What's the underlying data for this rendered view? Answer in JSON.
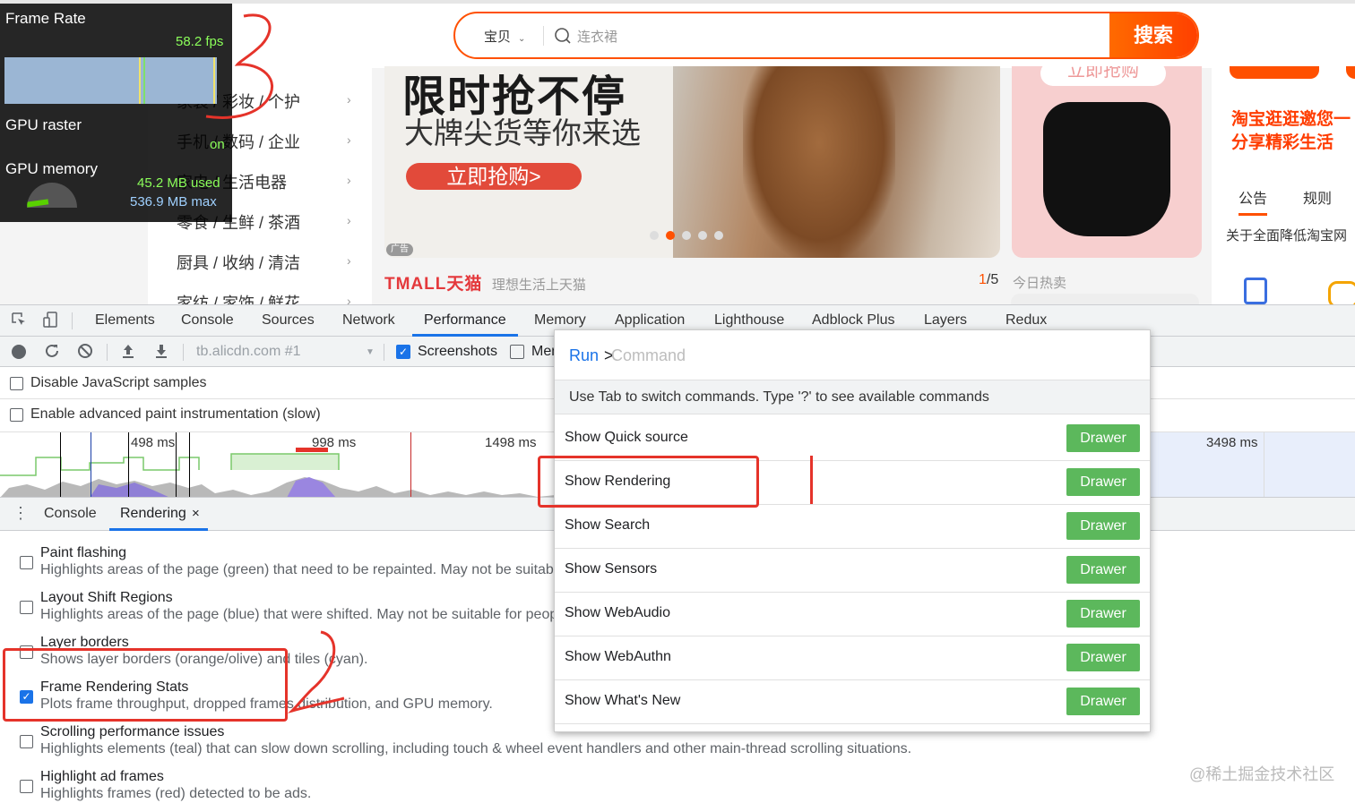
{
  "taobao": {
    "search": {
      "category": "宝贝",
      "placeholder": "连衣裙",
      "button": "搜索"
    },
    "categories": [
      "家装 / 彩妆 / 个护",
      "手机 / 数码 / 企业",
      "家电 / 生活电器",
      "零食 / 生鲜 / 茶酒",
      "厨具 / 收纳 / 清洁",
      "家纺 / 家饰 / 鲜花"
    ],
    "banner": {
      "headline": "限时抢不停",
      "subline": "大牌尖货等你来选",
      "cta": "立即抢购>",
      "ad_badge": "广告"
    },
    "right_card": {
      "button": "立即抢购"
    },
    "side": {
      "slogan1": "淘宝逛逛邀您一",
      "slogan2": "分享精彩生活",
      "tab1": "公告",
      "tab2": "规则",
      "notice": "关于全面降低淘宝网"
    },
    "tmall": {
      "logo": "TMALL天猫",
      "subtitle": "理想生活上天猫",
      "pager_current": "1",
      "pager_total": "/5",
      "hot": "今日热卖"
    }
  },
  "fps_meter": {
    "title": "Frame Rate",
    "fps": "58.2 fps",
    "gpu_raster_label": "GPU raster",
    "gpu_raster_state": "on",
    "gpu_memory_label": "GPU memory",
    "used": "45.2 MB used",
    "max": "536.9 MB max",
    "memory_fraction": 0.084
  },
  "devtools": {
    "tabs": [
      "Elements",
      "Console",
      "Sources",
      "Network",
      "Performance",
      "Memory",
      "Application",
      "Lighthouse",
      "Adblock Plus",
      "Layers",
      "Redux"
    ],
    "active_tab": "Performance",
    "toolbar": {
      "profile": "tb.alicdn.com #1",
      "screenshots": "Screenshots",
      "memory": "Mem"
    },
    "options": [
      "Disable JavaScript samples",
      "Enable advanced paint instrumentation (slow)"
    ],
    "timeline_labels": [
      "498 ms",
      "998 ms",
      "1498 ms",
      "3498 ms"
    ],
    "drawer": {
      "tab_console": "Console",
      "tab_rendering": "Rendering",
      "close": "×"
    },
    "rendering": [
      {
        "title": "Paint flashing",
        "desc": "Highlights areas of the page (green) that need to be repainted. May not be suitabl",
        "checked": false
      },
      {
        "title": "Layout Shift Regions",
        "desc": "Highlights areas of the page (blue) that were shifted. May not be suitable for peop",
        "checked": false
      },
      {
        "title": "Layer borders",
        "desc": "Shows layer borders (orange/olive) and tiles (cyan).",
        "checked": false
      },
      {
        "title": "Frame Rendering Stats",
        "desc": "Plots frame throughput, dropped frames distribution, and GPU memory.",
        "checked": true
      },
      {
        "title": "Scrolling performance issues",
        "desc": "Highlights elements (teal) that can slow down scrolling, including touch & wheel event handlers and other main-thread scrolling situations.",
        "checked": false
      },
      {
        "title": "Highlight ad frames",
        "desc": "Highlights frames (red) detected to be ads.",
        "checked": false
      }
    ]
  },
  "command_menu": {
    "run": "Run",
    "prompt": ">",
    "placeholder": "Command",
    "hint": "Use Tab to switch commands. Type '?' to see available commands",
    "items": [
      {
        "label": "Show Quick source",
        "badge": "Drawer"
      },
      {
        "label": "Show Rendering",
        "badge": "Drawer"
      },
      {
        "label": "Show Search",
        "badge": "Drawer"
      },
      {
        "label": "Show Sensors",
        "badge": "Drawer"
      },
      {
        "label": "Show WebAudio",
        "badge": "Drawer"
      },
      {
        "label": "Show WebAuthn",
        "badge": "Drawer"
      },
      {
        "label": "Show What's New",
        "badge": "Drawer"
      }
    ]
  },
  "watermark": "@稀土掘金技术社区",
  "colors": {
    "accent": "#1a73e8",
    "taobao": "#ff5000",
    "annotation": "#e5332a",
    "drawer_badge": "#5cb85c"
  }
}
